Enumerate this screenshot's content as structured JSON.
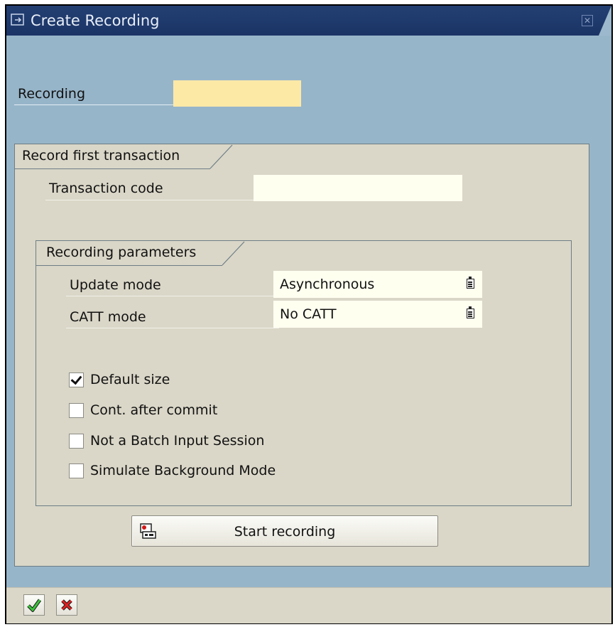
{
  "window": {
    "title": "Create Recording"
  },
  "form": {
    "recording_label": "Recording",
    "recording_value": ""
  },
  "group_first": {
    "title": "Record first transaction",
    "tcode_label": "Transaction code",
    "tcode_value": ""
  },
  "group_params": {
    "title": "Recording parameters",
    "update_mode_label": "Update mode",
    "update_mode_value": "Asynchronous",
    "catt_mode_label": "CATT mode",
    "catt_mode_value": "No CATT",
    "checkboxes": [
      {
        "label": "Default size",
        "checked": true
      },
      {
        "label": "Cont. after commit",
        "checked": false
      },
      {
        "label": "Not a Batch Input Session",
        "checked": false
      },
      {
        "label": "Simulate Background Mode",
        "checked": false
      }
    ]
  },
  "start_button": {
    "label": "Start recording",
    "icon": "record-icon"
  },
  "footer": {
    "ok_icon": "checkmark-icon",
    "cancel_icon": "cancel-x-icon"
  },
  "colors": {
    "titlebar": "#1b3466",
    "client": "#97b5c9",
    "panel": "#dad7c8",
    "required_field": "#fde9a6",
    "input_field": "#fffff0"
  }
}
